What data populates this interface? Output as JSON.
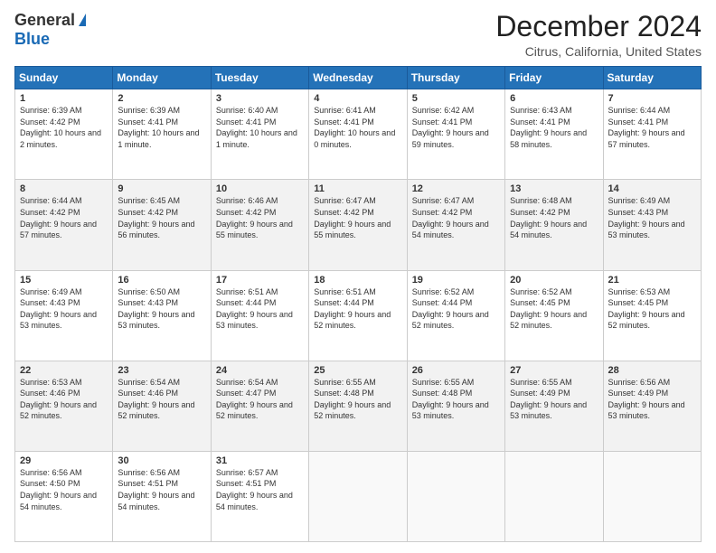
{
  "logo": {
    "general": "General",
    "blue": "Blue"
  },
  "header": {
    "title": "December 2024",
    "subtitle": "Citrus, California, United States"
  },
  "calendar": {
    "headers": [
      "Sunday",
      "Monday",
      "Tuesday",
      "Wednesday",
      "Thursday",
      "Friday",
      "Saturday"
    ],
    "rows": [
      [
        {
          "day": "1",
          "sunrise": "6:39 AM",
          "sunset": "4:42 PM",
          "daylight": "10 hours and 2 minutes."
        },
        {
          "day": "2",
          "sunrise": "6:39 AM",
          "sunset": "4:41 PM",
          "daylight": "10 hours and 1 minute."
        },
        {
          "day": "3",
          "sunrise": "6:40 AM",
          "sunset": "4:41 PM",
          "daylight": "10 hours and 1 minute."
        },
        {
          "day": "4",
          "sunrise": "6:41 AM",
          "sunset": "4:41 PM",
          "daylight": "10 hours and 0 minutes."
        },
        {
          "day": "5",
          "sunrise": "6:42 AM",
          "sunset": "4:41 PM",
          "daylight": "9 hours and 59 minutes."
        },
        {
          "day": "6",
          "sunrise": "6:43 AM",
          "sunset": "4:41 PM",
          "daylight": "9 hours and 58 minutes."
        },
        {
          "day": "7",
          "sunrise": "6:44 AM",
          "sunset": "4:41 PM",
          "daylight": "9 hours and 57 minutes."
        }
      ],
      [
        {
          "day": "8",
          "sunrise": "6:44 AM",
          "sunset": "4:42 PM",
          "daylight": "9 hours and 57 minutes."
        },
        {
          "day": "9",
          "sunrise": "6:45 AM",
          "sunset": "4:42 PM",
          "daylight": "9 hours and 56 minutes."
        },
        {
          "day": "10",
          "sunrise": "6:46 AM",
          "sunset": "4:42 PM",
          "daylight": "9 hours and 55 minutes."
        },
        {
          "day": "11",
          "sunrise": "6:47 AM",
          "sunset": "4:42 PM",
          "daylight": "9 hours and 55 minutes."
        },
        {
          "day": "12",
          "sunrise": "6:47 AM",
          "sunset": "4:42 PM",
          "daylight": "9 hours and 54 minutes."
        },
        {
          "day": "13",
          "sunrise": "6:48 AM",
          "sunset": "4:42 PM",
          "daylight": "9 hours and 54 minutes."
        },
        {
          "day": "14",
          "sunrise": "6:49 AM",
          "sunset": "4:43 PM",
          "daylight": "9 hours and 53 minutes."
        }
      ],
      [
        {
          "day": "15",
          "sunrise": "6:49 AM",
          "sunset": "4:43 PM",
          "daylight": "9 hours and 53 minutes."
        },
        {
          "day": "16",
          "sunrise": "6:50 AM",
          "sunset": "4:43 PM",
          "daylight": "9 hours and 53 minutes."
        },
        {
          "day": "17",
          "sunrise": "6:51 AM",
          "sunset": "4:44 PM",
          "daylight": "9 hours and 53 minutes."
        },
        {
          "day": "18",
          "sunrise": "6:51 AM",
          "sunset": "4:44 PM",
          "daylight": "9 hours and 52 minutes."
        },
        {
          "day": "19",
          "sunrise": "6:52 AM",
          "sunset": "4:44 PM",
          "daylight": "9 hours and 52 minutes."
        },
        {
          "day": "20",
          "sunrise": "6:52 AM",
          "sunset": "4:45 PM",
          "daylight": "9 hours and 52 minutes."
        },
        {
          "day": "21",
          "sunrise": "6:53 AM",
          "sunset": "4:45 PM",
          "daylight": "9 hours and 52 minutes."
        }
      ],
      [
        {
          "day": "22",
          "sunrise": "6:53 AM",
          "sunset": "4:46 PM",
          "daylight": "9 hours and 52 minutes."
        },
        {
          "day": "23",
          "sunrise": "6:54 AM",
          "sunset": "4:46 PM",
          "daylight": "9 hours and 52 minutes."
        },
        {
          "day": "24",
          "sunrise": "6:54 AM",
          "sunset": "4:47 PM",
          "daylight": "9 hours and 52 minutes."
        },
        {
          "day": "25",
          "sunrise": "6:55 AM",
          "sunset": "4:48 PM",
          "daylight": "9 hours and 52 minutes."
        },
        {
          "day": "26",
          "sunrise": "6:55 AM",
          "sunset": "4:48 PM",
          "daylight": "9 hours and 53 minutes."
        },
        {
          "day": "27",
          "sunrise": "6:55 AM",
          "sunset": "4:49 PM",
          "daylight": "9 hours and 53 minutes."
        },
        {
          "day": "28",
          "sunrise": "6:56 AM",
          "sunset": "4:49 PM",
          "daylight": "9 hours and 53 minutes."
        }
      ],
      [
        {
          "day": "29",
          "sunrise": "6:56 AM",
          "sunset": "4:50 PM",
          "daylight": "9 hours and 54 minutes."
        },
        {
          "day": "30",
          "sunrise": "6:56 AM",
          "sunset": "4:51 PM",
          "daylight": "9 hours and 54 minutes."
        },
        {
          "day": "31",
          "sunrise": "6:57 AM",
          "sunset": "4:51 PM",
          "daylight": "9 hours and 54 minutes."
        },
        null,
        null,
        null,
        null
      ]
    ]
  }
}
